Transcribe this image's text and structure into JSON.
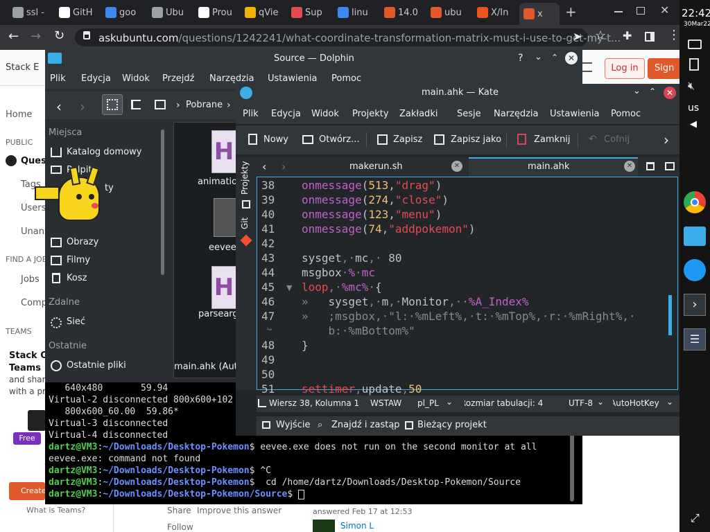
{
  "browser": {
    "tabs": [
      {
        "label": "ssl -",
        "fav": "chrome-icon",
        "color": "#9aa0a6"
      },
      {
        "label": "GitH",
        "fav": "github-icon",
        "color": "#ffffff"
      },
      {
        "label": "goo",
        "fav": "google-icon",
        "color": "#4285f4"
      },
      {
        "label": "Ubu",
        "fav": "globe-icon",
        "color": "#9aa0a6"
      },
      {
        "label": "Prou",
        "fav": "text-doc-icon",
        "color": "#ffffff"
      },
      {
        "label": "qVie",
        "fav": "qview-icon",
        "color": "#f2b400"
      },
      {
        "label": "Sup",
        "fav": "superuser-icon",
        "color": "#e34b55"
      },
      {
        "label": "linu",
        "fav": "google-icon",
        "color": "#4285f4"
      },
      {
        "label": "14.0",
        "fav": "askubuntu-icon",
        "color": "#e0592a"
      },
      {
        "label": "ubu",
        "fav": "askubuntu-icon",
        "color": "#e0592a"
      },
      {
        "label": "X/In",
        "fav": "ubuntu-icon",
        "color": "#e95420"
      },
      {
        "label": "x",
        "fav": "askubuntu-icon",
        "color": "#e0592a"
      }
    ],
    "url_domain": "askubuntu.com",
    "url_path": "/questions/1242241/what-coordinate-transformation-matrix-must-i-use-to-get-my-t..."
  },
  "site": {
    "logo": "Stack E",
    "login": "Log in",
    "signup": "Sign u",
    "sidebar": {
      "home": "Home",
      "public": "PUBLIC",
      "questions": "Quest",
      "tags": "Tags",
      "users": "Users",
      "unanswered": "Unans",
      "find_jobs": "FIND A JOB",
      "jobs": "Jobs",
      "companies": "Comp",
      "teams": "TEAMS",
      "teams_title": "Stack Ov",
      "teams_title2": "Teams",
      "teams_desc": "and shar",
      "teams_desc2": "with a pri",
      "free": "Free",
      "create": "Create",
      "what_teams": "What is Teams?"
    },
    "footer": {
      "share": "Share",
      "improve": "Improve this answer",
      "follow": "Follow",
      "answered": "answered Feb 17 at 12:53",
      "user": "Simon L"
    }
  },
  "dolphin": {
    "title": "Source — Dolphin",
    "menu": [
      "Plik",
      "Edycja",
      "Widok",
      "Przejdź",
      "Narzędzia",
      "Ustawienia",
      "Pomoc"
    ],
    "breadcrumb": [
      "Pobrane"
    ],
    "places_header": "Miejsca",
    "places": [
      "Katalog domowy",
      "Pulpit",
      "Obrazy",
      "Filmy",
      "Kosz"
    ],
    "remote_header": "Zdalne",
    "remote": [
      "Sieć"
    ],
    "recent_header": "Ostatnie",
    "recent": [
      "Ostatnie pliki"
    ],
    "partial_label": "ty",
    "files": [
      "animatio",
      "eevee.",
      "parsearg",
      "main.ahk (Auto"
    ]
  },
  "konsole": {
    "lines": [
      {
        "type": "plain",
        "text": "   640x480       59.94"
      },
      {
        "type": "plain",
        "text": "Virtual-2 disconnected 800x600+102"
      },
      {
        "type": "plain",
        "text": "   800x600_60.00  59.86*"
      },
      {
        "type": "plain",
        "text": "Virtual-3 disconnected"
      },
      {
        "type": "plain",
        "text": "Virtual-4 disconnected"
      },
      {
        "type": "prompt",
        "user": "dartz@VM3",
        "path": "~/Downloads/Desktop-Pokemon",
        "cmd": " eevee.exe does not run on the second monitor at all"
      },
      {
        "type": "plain",
        "text": "eevee.exe: command not found"
      },
      {
        "type": "prompt",
        "user": "dartz@VM3",
        "path": "~/Downloads/Desktop-Pokemon",
        "cmd": " ^C"
      },
      {
        "type": "prompt",
        "user": "dartz@VM3",
        "path": "~/Downloads/Desktop-Pokemon",
        "cmd": "  cd /home/dartz/Downloads/Desktop-Pokemon/Source"
      },
      {
        "type": "prompt",
        "user": "dartz@VM3",
        "path": "~/Downloads/Desktop-Pokemon/Source",
        "cmd": " "
      }
    ]
  },
  "kate": {
    "title": "main.ahk — Kate",
    "menu": [
      "Plik",
      "Edycja",
      "Widok",
      "Projekty",
      "Zakładki",
      "Sesje",
      "Narzędzia",
      "Ustawienia",
      "Pomoc"
    ],
    "toolbar": {
      "new": "Nowy",
      "open": "Otwórz...",
      "save": "Zapisz",
      "save_as": "Zapisz jako",
      "close": "Zamknij",
      "undo": "Cofnij"
    },
    "side_tabs": [
      "Projekty",
      "Git"
    ],
    "tabs": [
      "makerun.sh",
      "main.ahk"
    ],
    "lines": [
      {
        "n": "38",
        "html": "<span class='fn'>onmessage</span>(<span class='num'>513</span>,<span class='str'>\"drag\"</span>)"
      },
      {
        "n": "39",
        "html": "<span class='fn'>onmessage</span>(<span class='num'>274</span>,<span class='str'>\"close\"</span>)"
      },
      {
        "n": "40",
        "html": "<span class='fn'>onmessage</span>(<span class='num'>123</span>,<span class='str'>\"menu\"</span>)"
      },
      {
        "n": "41",
        "html": "<span class='fn'>onmessage</span>(<span class='num'>74</span>,<span class='str'>\"addpokemon\"</span>)"
      },
      {
        "n": "42",
        "html": ""
      },
      {
        "n": "43",
        "html": "sysget<span class='dim'>,·</span>mc<span class='dim'>,·</span> 80"
      },
      {
        "n": "44",
        "html": "msgbox<span class='dim'>·</span><span class='fn'>%</span><span class='dim'>·</span><span class='fn'>mc</span>"
      },
      {
        "n": "45",
        "html": "<span class='kw'>loop</span><span class='dim'>,·</span><span class='fn'>%mc%</span><span class='dim'>·</span>{"
      },
      {
        "n": "46",
        "html": "<span class='dim'>»   </span>sysget<span class='dim'>,·</span>m<span class='dim'>,·</span>Monitor<span class='dim'>,··</span><span class='fn'>%A_Index%</span>"
      },
      {
        "n": "47",
        "html": "<span class='dim'>»   ;msgbox,·\"l:·%mLeft%,·t:·%mTop%,·r:·%mRight%,·</span>"
      },
      {
        "n": "",
        "html": "<span class='dim'>    b:·%mBottom%\"</span>"
      },
      {
        "n": "48",
        "html": "}"
      },
      {
        "n": "49",
        "html": ""
      },
      {
        "n": "50",
        "html": ""
      },
      {
        "n": "51",
        "html": "<span class='kw'>settimer</span><span class='dim'>,</span>update<span class='dim'>,</span><span class='num'>50</span>"
      }
    ],
    "status": {
      "position": "Wiersz 38, Kolumna 1",
      "mode": "WSTAW",
      "lang": "pl_PL",
      "tab": "Rozmiar tabulacji: 4",
      "enc": "UTF-8",
      "syntax": "AutoHotKey"
    },
    "bottom": {
      "output": "Wyjście",
      "search": "Znajdź i zastąp",
      "project": "Bieżący projekt"
    }
  },
  "clock": {
    "time": "22:42",
    "date": "30Mar22"
  },
  "tray": {
    "lang": "us"
  }
}
